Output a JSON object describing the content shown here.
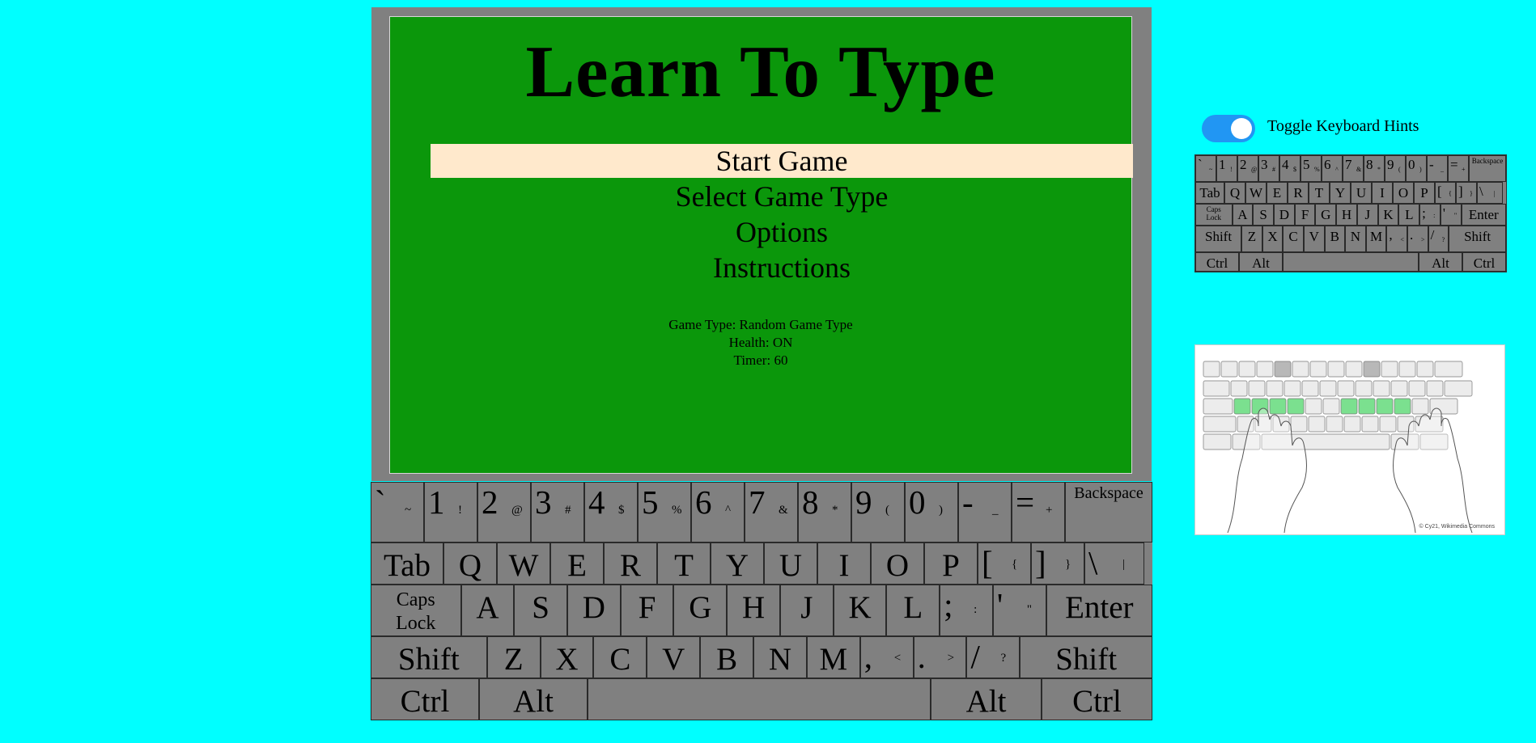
{
  "game": {
    "title": "Learn To Type",
    "menu": [
      {
        "label": "Start Game",
        "selected": true
      },
      {
        "label": "Select Game Type",
        "selected": false
      },
      {
        "label": "Options",
        "selected": false
      },
      {
        "label": "Instructions",
        "selected": false
      }
    ],
    "info": {
      "game_type": "Game Type: Random Game Type",
      "health": "Health: ON",
      "timer": "Timer: 60"
    }
  },
  "hints": {
    "toggle_label": "Toggle Keyboard Hints",
    "toggle_on": true
  },
  "finger_chart": {
    "credit": "© Cy21, Wikimedia Commons"
  },
  "colors": {
    "background": "#00ffff",
    "frame": "#808080",
    "screen": "#0b970b",
    "selected_item": "#ffe9cc",
    "toggle_on": "#2196f3",
    "home_row_hint": "#7be08f"
  },
  "keyboard": {
    "rows": [
      [
        {
          "main": "`",
          "shift": "~",
          "name": "backtick"
        },
        {
          "main": "1",
          "shift": "!",
          "name": "1"
        },
        {
          "main": "2",
          "shift": "@",
          "name": "2"
        },
        {
          "main": "3",
          "shift": "#",
          "name": "3"
        },
        {
          "main": "4",
          "shift": "$",
          "name": "4"
        },
        {
          "main": "5",
          "shift": "%",
          "name": "5"
        },
        {
          "main": "6",
          "shift": "^",
          "name": "6"
        },
        {
          "main": "7",
          "shift": "&",
          "name": "7"
        },
        {
          "main": "8",
          "shift": "*",
          "name": "8"
        },
        {
          "main": "9",
          "shift": "(",
          "name": "9"
        },
        {
          "main": "0",
          "shift": ")",
          "name": "0"
        },
        {
          "main": "-",
          "shift": "_",
          "name": "minus"
        },
        {
          "main": "=",
          "shift": "+",
          "name": "equals"
        },
        {
          "label": "Backspace",
          "name": "backspace"
        }
      ],
      [
        {
          "label": "Tab",
          "name": "tab"
        },
        {
          "label": "Q",
          "name": "q"
        },
        {
          "label": "W",
          "name": "w"
        },
        {
          "label": "E",
          "name": "e"
        },
        {
          "label": "R",
          "name": "r"
        },
        {
          "label": "T",
          "name": "t"
        },
        {
          "label": "Y",
          "name": "y"
        },
        {
          "label": "U",
          "name": "u"
        },
        {
          "label": "I",
          "name": "i"
        },
        {
          "label": "O",
          "name": "o"
        },
        {
          "label": "P",
          "name": "p"
        },
        {
          "main": "[",
          "shift": "{",
          "name": "left-bracket"
        },
        {
          "main": "]",
          "shift": "}",
          "name": "right-bracket"
        },
        {
          "main": "\\",
          "shift": "|",
          "name": "backslash"
        }
      ],
      [
        {
          "label": "Caps Lock",
          "name": "caps-lock"
        },
        {
          "label": "A",
          "name": "a"
        },
        {
          "label": "S",
          "name": "s"
        },
        {
          "label": "D",
          "name": "d"
        },
        {
          "label": "F",
          "name": "f"
        },
        {
          "label": "G",
          "name": "g"
        },
        {
          "label": "H",
          "name": "h"
        },
        {
          "label": "J",
          "name": "j"
        },
        {
          "label": "K",
          "name": "k"
        },
        {
          "label": "L",
          "name": "l"
        },
        {
          "main": ";",
          "shift": ":",
          "name": "semicolon"
        },
        {
          "main": "'",
          "shift": "\"",
          "name": "quote"
        },
        {
          "label": "Enter",
          "name": "enter"
        }
      ],
      [
        {
          "label": "Shift",
          "name": "left-shift"
        },
        {
          "label": "Z",
          "name": "z"
        },
        {
          "label": "X",
          "name": "x"
        },
        {
          "label": "C",
          "name": "c"
        },
        {
          "label": "V",
          "name": "v"
        },
        {
          "label": "B",
          "name": "b"
        },
        {
          "label": "N",
          "name": "n"
        },
        {
          "label": "M",
          "name": "m"
        },
        {
          "main": ",",
          "shift": "<",
          "name": "comma"
        },
        {
          "main": ".",
          "shift": ">",
          "name": "period"
        },
        {
          "main": "/",
          "shift": "?",
          "name": "slash"
        },
        {
          "label": "Shift",
          "name": "right-shift"
        }
      ],
      [
        {
          "label": "Ctrl",
          "name": "left-ctrl"
        },
        {
          "label": "Alt",
          "name": "left-alt"
        },
        {
          "label": "",
          "name": "space"
        },
        {
          "label": "Alt",
          "name": "right-alt"
        },
        {
          "label": "Ctrl",
          "name": "right-ctrl"
        }
      ]
    ]
  }
}
